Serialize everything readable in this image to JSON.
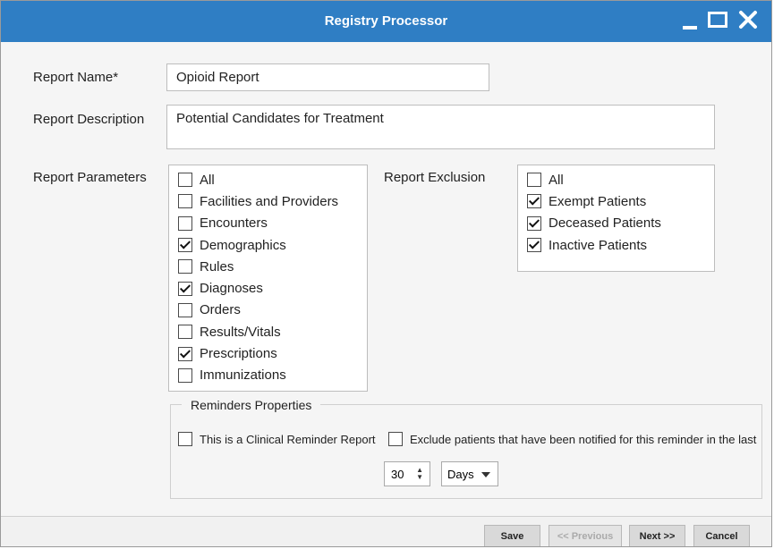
{
  "window": {
    "title": "Registry Processor"
  },
  "form": {
    "report_name_label": "Report Name*",
    "report_name_value": "Opioid Report",
    "report_description_label": "Report Description",
    "report_description_value": "Potential Candidates for Treatment",
    "report_parameters_label": "Report Parameters",
    "report_exclusion_label": "Report Exclusion"
  },
  "parameters": [
    {
      "label": "All",
      "checked": false
    },
    {
      "label": "Facilities and Providers",
      "checked": false
    },
    {
      "label": "Encounters",
      "checked": false
    },
    {
      "label": "Demographics",
      "checked": true
    },
    {
      "label": "Rules",
      "checked": false
    },
    {
      "label": "Diagnoses",
      "checked": true
    },
    {
      "label": "Orders",
      "checked": false
    },
    {
      "label": "Results/Vitals",
      "checked": false
    },
    {
      "label": "Prescriptions",
      "checked": true
    },
    {
      "label": "Immunizations",
      "checked": false
    }
  ],
  "exclusions": [
    {
      "label": "All",
      "checked": false
    },
    {
      "label": "Exempt Patients",
      "checked": true
    },
    {
      "label": "Deceased Patients",
      "checked": true
    },
    {
      "label": "Inactive Patients",
      "checked": true
    }
  ],
  "reminders": {
    "legend": "Reminders Properties",
    "clinical_label": "This is a Clinical Reminder Report",
    "exclude_label": "Exclude patients that have been notified for this reminder in the last",
    "period_value": "30",
    "unit_value": "Days"
  },
  "buttons": {
    "save": "Save",
    "previous": "<< Previous",
    "next": "Next >>",
    "cancel": "Cancel"
  }
}
